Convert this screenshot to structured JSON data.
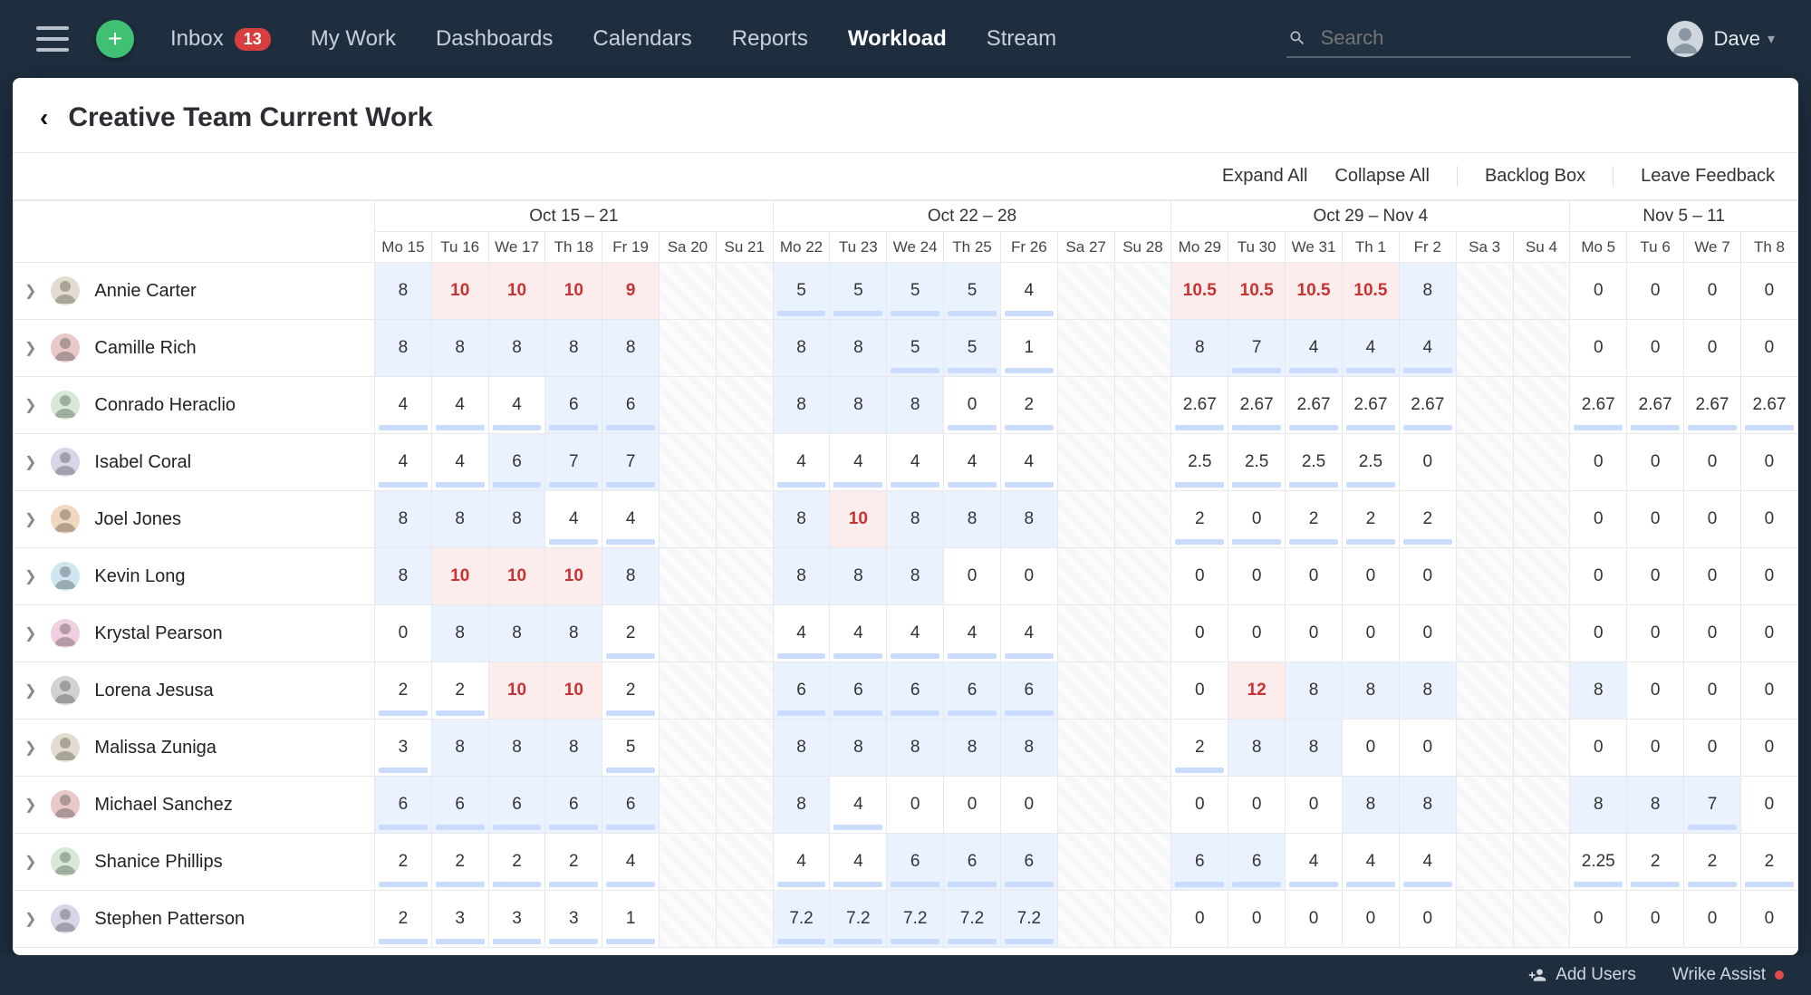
{
  "nav": {
    "inbox_label": "Inbox",
    "inbox_badge": "13",
    "mywork_label": "My Work",
    "dashboards_label": "Dashboards",
    "calendars_label": "Calendars",
    "reports_label": "Reports",
    "workload_label": "Workload",
    "stream_label": "Stream",
    "search_placeholder": "Search",
    "user_name": "Dave"
  },
  "header": {
    "title": "Creative Team Current Work"
  },
  "toolbar": {
    "expand_label": "Expand All",
    "collapse_label": "Collapse All",
    "backlog_label": "Backlog Box",
    "feedback_label": "Leave Feedback"
  },
  "footer": {
    "add_users_label": "Add Users",
    "assist_label": "Wrike Assist"
  },
  "weeks": [
    {
      "label": "Oct 15 – 21",
      "days": [
        "Mo 15",
        "Tu 16",
        "We 17",
        "Th 18",
        "Fr 19",
        "Sa 20",
        "Su 21"
      ]
    },
    {
      "label": "Oct 22 – 28",
      "days": [
        "Mo 22",
        "Tu 23",
        "We 24",
        "Th 25",
        "Fr 26",
        "Sa 27",
        "Su 28"
      ]
    },
    {
      "label": "Oct 29 – Nov 4",
      "days": [
        "Mo 29",
        "Tu 30",
        "We 31",
        "Th 1",
        "Fr 2",
        "Sa 3",
        "Su 4"
      ]
    },
    {
      "label": "Nov 5 – 11",
      "days": [
        "Mo 5",
        "Tu 6",
        "We 7",
        "Th 8"
      ]
    }
  ],
  "people": [
    {
      "name": "Annie Carter",
      "av": "avA",
      "cells": [
        {
          "v": "8",
          "s": "blue"
        },
        {
          "v": "10",
          "s": "red"
        },
        {
          "v": "10",
          "s": "red"
        },
        {
          "v": "10",
          "s": "red"
        },
        {
          "v": "9",
          "s": "red"
        },
        {
          "s": "weekend"
        },
        {
          "s": "weekend"
        },
        {
          "v": "5",
          "s": "blue",
          "u": 1
        },
        {
          "v": "5",
          "s": "blue",
          "u": 1
        },
        {
          "v": "5",
          "s": "blue",
          "u": 1
        },
        {
          "v": "5",
          "s": "blue",
          "u": 1
        },
        {
          "v": "4",
          "u": 1
        },
        {
          "s": "weekend"
        },
        {
          "s": "weekend"
        },
        {
          "v": "10.5",
          "s": "red"
        },
        {
          "v": "10.5",
          "s": "red"
        },
        {
          "v": "10.5",
          "s": "red"
        },
        {
          "v": "10.5",
          "s": "red"
        },
        {
          "v": "8",
          "s": "blue"
        },
        {
          "s": "weekend"
        },
        {
          "s": "weekend"
        },
        {
          "v": "0"
        },
        {
          "v": "0"
        },
        {
          "v": "0"
        },
        {
          "v": "0"
        }
      ]
    },
    {
      "name": "Camille Rich",
      "av": "avB",
      "cells": [
        {
          "v": "8",
          "s": "blue"
        },
        {
          "v": "8",
          "s": "blue"
        },
        {
          "v": "8",
          "s": "blue"
        },
        {
          "v": "8",
          "s": "blue"
        },
        {
          "v": "8",
          "s": "blue"
        },
        {
          "s": "weekend"
        },
        {
          "s": "weekend"
        },
        {
          "v": "8",
          "s": "blue"
        },
        {
          "v": "8",
          "s": "blue"
        },
        {
          "v": "5",
          "s": "blue",
          "u": 1
        },
        {
          "v": "5",
          "s": "blue",
          "u": 1
        },
        {
          "v": "1",
          "u": 1
        },
        {
          "s": "weekend"
        },
        {
          "s": "weekend"
        },
        {
          "v": "8",
          "s": "blue"
        },
        {
          "v": "7",
          "s": "blue",
          "u": 1
        },
        {
          "v": "4",
          "s": "blue",
          "u": 1
        },
        {
          "v": "4",
          "s": "blue",
          "u": 1
        },
        {
          "v": "4",
          "s": "blue",
          "u": 1
        },
        {
          "s": "weekend"
        },
        {
          "s": "weekend"
        },
        {
          "v": "0"
        },
        {
          "v": "0"
        },
        {
          "v": "0"
        },
        {
          "v": "0"
        }
      ]
    },
    {
      "name": "Conrado Heraclio",
      "av": "avC",
      "cells": [
        {
          "v": "4",
          "u": 1
        },
        {
          "v": "4",
          "u": 1
        },
        {
          "v": "4",
          "u": 1
        },
        {
          "v": "6",
          "s": "blue",
          "u": 1
        },
        {
          "v": "6",
          "s": "blue",
          "u": 1
        },
        {
          "s": "weekend"
        },
        {
          "s": "weekend"
        },
        {
          "v": "8",
          "s": "blue"
        },
        {
          "v": "8",
          "s": "blue"
        },
        {
          "v": "8",
          "s": "blue"
        },
        {
          "v": "0",
          "u": 1
        },
        {
          "v": "2",
          "u": 1
        },
        {
          "s": "weekend"
        },
        {
          "s": "weekend"
        },
        {
          "v": "2.67",
          "u": 1
        },
        {
          "v": "2.67",
          "u": 1
        },
        {
          "v": "2.67",
          "u": 1
        },
        {
          "v": "2.67",
          "u": 1
        },
        {
          "v": "2.67",
          "u": 1
        },
        {
          "s": "weekend"
        },
        {
          "s": "weekend"
        },
        {
          "v": "2.67",
          "u": 1
        },
        {
          "v": "2.67",
          "u": 1
        },
        {
          "v": "2.67",
          "u": 1
        },
        {
          "v": "2.67",
          "u": 1
        }
      ]
    },
    {
      "name": "Isabel Coral",
      "av": "avD",
      "cells": [
        {
          "v": "4",
          "u": 1
        },
        {
          "v": "4",
          "u": 1
        },
        {
          "v": "6",
          "s": "blue",
          "u": 1
        },
        {
          "v": "7",
          "s": "blue",
          "u": 1
        },
        {
          "v": "7",
          "s": "blue",
          "u": 1
        },
        {
          "s": "weekend"
        },
        {
          "s": "weekend"
        },
        {
          "v": "4",
          "u": 1
        },
        {
          "v": "4",
          "u": 1
        },
        {
          "v": "4",
          "u": 1
        },
        {
          "v": "4",
          "u": 1
        },
        {
          "v": "4",
          "u": 1
        },
        {
          "s": "weekend"
        },
        {
          "s": "weekend"
        },
        {
          "v": "2.5",
          "u": 1
        },
        {
          "v": "2.5",
          "u": 1
        },
        {
          "v": "2.5",
          "u": 1
        },
        {
          "v": "2.5",
          "u": 1
        },
        {
          "v": "0"
        },
        {
          "s": "weekend"
        },
        {
          "s": "weekend"
        },
        {
          "v": "0"
        },
        {
          "v": "0"
        },
        {
          "v": "0"
        },
        {
          "v": "0"
        }
      ]
    },
    {
      "name": "Joel Jones",
      "av": "avE",
      "cells": [
        {
          "v": "8",
          "s": "blue"
        },
        {
          "v": "8",
          "s": "blue"
        },
        {
          "v": "8",
          "s": "blue"
        },
        {
          "v": "4",
          "u": 1
        },
        {
          "v": "4",
          "u": 1
        },
        {
          "s": "weekend"
        },
        {
          "s": "weekend"
        },
        {
          "v": "8",
          "s": "blue"
        },
        {
          "v": "10",
          "s": "red"
        },
        {
          "v": "8",
          "s": "blue"
        },
        {
          "v": "8",
          "s": "blue"
        },
        {
          "v": "8",
          "s": "blue"
        },
        {
          "s": "weekend"
        },
        {
          "s": "weekend"
        },
        {
          "v": "2",
          "u": 1
        },
        {
          "v": "0",
          "u": 1
        },
        {
          "v": "2",
          "u": 1
        },
        {
          "v": "2",
          "u": 1
        },
        {
          "v": "2",
          "u": 1
        },
        {
          "s": "weekend"
        },
        {
          "s": "weekend"
        },
        {
          "v": "0"
        },
        {
          "v": "0"
        },
        {
          "v": "0"
        },
        {
          "v": "0"
        }
      ]
    },
    {
      "name": "Kevin Long",
      "av": "avF",
      "cells": [
        {
          "v": "8",
          "s": "blue"
        },
        {
          "v": "10",
          "s": "red"
        },
        {
          "v": "10",
          "s": "red"
        },
        {
          "v": "10",
          "s": "red"
        },
        {
          "v": "8",
          "s": "blue"
        },
        {
          "s": "weekend"
        },
        {
          "s": "weekend"
        },
        {
          "v": "8",
          "s": "blue"
        },
        {
          "v": "8",
          "s": "blue"
        },
        {
          "v": "8",
          "s": "blue"
        },
        {
          "v": "0"
        },
        {
          "v": "0"
        },
        {
          "s": "weekend"
        },
        {
          "s": "weekend"
        },
        {
          "v": "0"
        },
        {
          "v": "0"
        },
        {
          "v": "0"
        },
        {
          "v": "0"
        },
        {
          "v": "0"
        },
        {
          "s": "weekend"
        },
        {
          "s": "weekend"
        },
        {
          "v": "0"
        },
        {
          "v": "0"
        },
        {
          "v": "0"
        },
        {
          "v": "0"
        }
      ]
    },
    {
      "name": "Krystal Pearson",
      "av": "avG",
      "cells": [
        {
          "v": "0"
        },
        {
          "v": "8",
          "s": "blue"
        },
        {
          "v": "8",
          "s": "blue"
        },
        {
          "v": "8",
          "s": "blue"
        },
        {
          "v": "2",
          "u": 1
        },
        {
          "s": "weekend"
        },
        {
          "s": "weekend"
        },
        {
          "v": "4",
          "u": 1
        },
        {
          "v": "4",
          "u": 1
        },
        {
          "v": "4",
          "u": 1
        },
        {
          "v": "4",
          "u": 1
        },
        {
          "v": "4",
          "u": 1
        },
        {
          "s": "weekend"
        },
        {
          "s": "weekend"
        },
        {
          "v": "0"
        },
        {
          "v": "0"
        },
        {
          "v": "0"
        },
        {
          "v": "0"
        },
        {
          "v": "0"
        },
        {
          "s": "weekend"
        },
        {
          "s": "weekend"
        },
        {
          "v": "0"
        },
        {
          "v": "0"
        },
        {
          "v": "0"
        },
        {
          "v": "0"
        }
      ]
    },
    {
      "name": "Lorena Jesusa",
      "av": "avH",
      "cells": [
        {
          "v": "2",
          "u": 1
        },
        {
          "v": "2",
          "u": 1
        },
        {
          "v": "10",
          "s": "red"
        },
        {
          "v": "10",
          "s": "red"
        },
        {
          "v": "2",
          "u": 1
        },
        {
          "s": "weekend"
        },
        {
          "s": "weekend"
        },
        {
          "v": "6",
          "s": "blue",
          "u": 1
        },
        {
          "v": "6",
          "s": "blue",
          "u": 1
        },
        {
          "v": "6",
          "s": "blue",
          "u": 1
        },
        {
          "v": "6",
          "s": "blue",
          "u": 1
        },
        {
          "v": "6",
          "s": "blue",
          "u": 1
        },
        {
          "s": "weekend"
        },
        {
          "s": "weekend"
        },
        {
          "v": "0"
        },
        {
          "v": "12",
          "s": "red"
        },
        {
          "v": "8",
          "s": "blue"
        },
        {
          "v": "8",
          "s": "blue"
        },
        {
          "v": "8",
          "s": "blue"
        },
        {
          "s": "weekend"
        },
        {
          "s": "weekend"
        },
        {
          "v": "8",
          "s": "blue"
        },
        {
          "v": "0"
        },
        {
          "v": "0"
        },
        {
          "v": "0"
        }
      ]
    },
    {
      "name": "Malissa Zuniga",
      "av": "avA",
      "cells": [
        {
          "v": "3",
          "u": 1
        },
        {
          "v": "8",
          "s": "blue"
        },
        {
          "v": "8",
          "s": "blue"
        },
        {
          "v": "8",
          "s": "blue"
        },
        {
          "v": "5",
          "u": 1
        },
        {
          "s": "weekend"
        },
        {
          "s": "weekend"
        },
        {
          "v": "8",
          "s": "blue"
        },
        {
          "v": "8",
          "s": "blue"
        },
        {
          "v": "8",
          "s": "blue"
        },
        {
          "v": "8",
          "s": "blue"
        },
        {
          "v": "8",
          "s": "blue"
        },
        {
          "s": "weekend"
        },
        {
          "s": "weekend"
        },
        {
          "v": "2",
          "u": 1
        },
        {
          "v": "8",
          "s": "blue"
        },
        {
          "v": "8",
          "s": "blue"
        },
        {
          "v": "0"
        },
        {
          "v": "0"
        },
        {
          "s": "weekend"
        },
        {
          "s": "weekend"
        },
        {
          "v": "0"
        },
        {
          "v": "0"
        },
        {
          "v": "0"
        },
        {
          "v": "0"
        }
      ]
    },
    {
      "name": "Michael Sanchez",
      "av": "avB",
      "cells": [
        {
          "v": "6",
          "s": "blue",
          "u": 1
        },
        {
          "v": "6",
          "s": "blue",
          "u": 1
        },
        {
          "v": "6",
          "s": "blue",
          "u": 1
        },
        {
          "v": "6",
          "s": "blue",
          "u": 1
        },
        {
          "v": "6",
          "s": "blue",
          "u": 1
        },
        {
          "s": "weekend"
        },
        {
          "s": "weekend"
        },
        {
          "v": "8",
          "s": "blue"
        },
        {
          "v": "4",
          "u": 1
        },
        {
          "v": "0"
        },
        {
          "v": "0"
        },
        {
          "v": "0"
        },
        {
          "s": "weekend"
        },
        {
          "s": "weekend"
        },
        {
          "v": "0"
        },
        {
          "v": "0"
        },
        {
          "v": "0"
        },
        {
          "v": "8",
          "s": "blue"
        },
        {
          "v": "8",
          "s": "blue"
        },
        {
          "s": "weekend"
        },
        {
          "s": "weekend"
        },
        {
          "v": "8",
          "s": "blue"
        },
        {
          "v": "8",
          "s": "blue"
        },
        {
          "v": "7",
          "s": "blue",
          "u": 1
        },
        {
          "v": "0"
        }
      ]
    },
    {
      "name": "Shanice Phillips",
      "av": "avC",
      "cells": [
        {
          "v": "2",
          "u": 1
        },
        {
          "v": "2",
          "u": 1
        },
        {
          "v": "2",
          "u": 1
        },
        {
          "v": "2",
          "u": 1
        },
        {
          "v": "4",
          "u": 1
        },
        {
          "s": "weekend"
        },
        {
          "s": "weekend"
        },
        {
          "v": "4",
          "u": 1
        },
        {
          "v": "4",
          "u": 1
        },
        {
          "v": "6",
          "s": "blue",
          "u": 1
        },
        {
          "v": "6",
          "s": "blue",
          "u": 1
        },
        {
          "v": "6",
          "s": "blue",
          "u": 1
        },
        {
          "s": "weekend"
        },
        {
          "s": "weekend"
        },
        {
          "v": "6",
          "s": "blue",
          "u": 1
        },
        {
          "v": "6",
          "s": "blue",
          "u": 1
        },
        {
          "v": "4",
          "u": 1
        },
        {
          "v": "4",
          "u": 1
        },
        {
          "v": "4",
          "u": 1
        },
        {
          "s": "weekend"
        },
        {
          "s": "weekend"
        },
        {
          "v": "2.25",
          "u": 1
        },
        {
          "v": "2",
          "u": 1
        },
        {
          "v": "2",
          "u": 1
        },
        {
          "v": "2",
          "u": 1
        }
      ]
    },
    {
      "name": "Stephen Patterson",
      "av": "avD",
      "cells": [
        {
          "v": "2",
          "u": 1
        },
        {
          "v": "3",
          "u": 1
        },
        {
          "v": "3",
          "u": 1
        },
        {
          "v": "3",
          "u": 1
        },
        {
          "v": "1",
          "u": 1
        },
        {
          "s": "weekend"
        },
        {
          "s": "weekend"
        },
        {
          "v": "7.2",
          "s": "blue",
          "u": 1
        },
        {
          "v": "7.2",
          "s": "blue",
          "u": 1
        },
        {
          "v": "7.2",
          "s": "blue",
          "u": 1
        },
        {
          "v": "7.2",
          "s": "blue",
          "u": 1
        },
        {
          "v": "7.2",
          "s": "blue",
          "u": 1
        },
        {
          "s": "weekend"
        },
        {
          "s": "weekend"
        },
        {
          "v": "0"
        },
        {
          "v": "0"
        },
        {
          "v": "0"
        },
        {
          "v": "0"
        },
        {
          "v": "0"
        },
        {
          "s": "weekend"
        },
        {
          "s": "weekend"
        },
        {
          "v": "0"
        },
        {
          "v": "0"
        },
        {
          "v": "0"
        },
        {
          "v": "0"
        }
      ]
    }
  ]
}
